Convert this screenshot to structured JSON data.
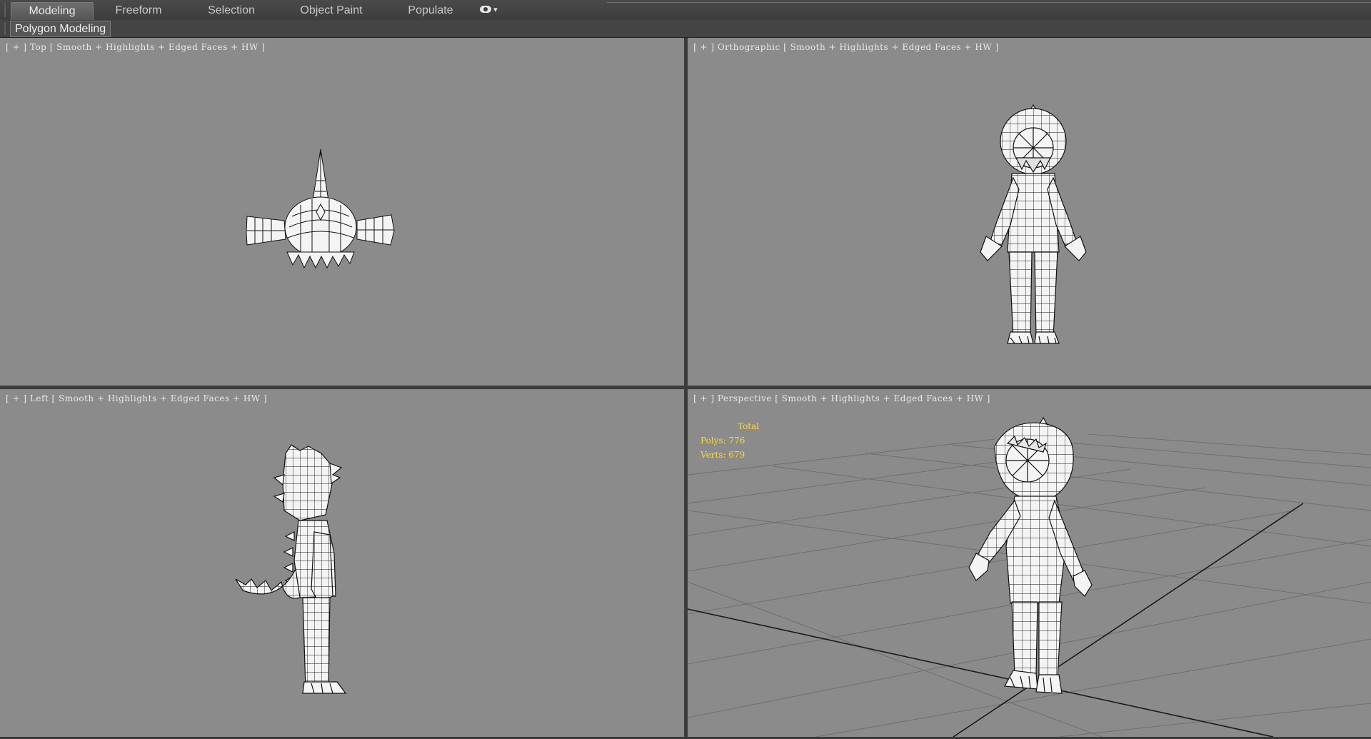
{
  "ribbon": {
    "tabs": [
      {
        "label": "Modeling",
        "active": true
      },
      {
        "label": "Freeform",
        "active": false
      },
      {
        "label": "Selection",
        "active": false
      },
      {
        "label": "Object Paint",
        "active": false
      },
      {
        "label": "Populate",
        "active": false
      }
    ],
    "extension_arrow": "▾"
  },
  "subribbon": {
    "label": "Polygon Modeling"
  },
  "viewports": {
    "top": {
      "plus": "[ + ]",
      "view": "Top",
      "shading": "[ Smooth + Highlights + Edged Faces + HW ]"
    },
    "orthographic": {
      "plus": "[ + ]",
      "view": "Orthographic",
      "shading": "[ Smooth + Highlights + Edged Faces + HW ]"
    },
    "left": {
      "plus": "[ + ]",
      "view": "Left",
      "shading": "[ Smooth + Highlights + Edged Faces + HW ]"
    },
    "perspective": {
      "plus": "[ + ]",
      "view": "Perspective",
      "shading": "[ Smooth + Highlights + Edged Faces + HW ]",
      "stats": {
        "title": "Total",
        "polys": "Polys: 776",
        "verts": "Verts: 679"
      }
    }
  },
  "colors": {
    "viewport_bg": "#8b8b8b",
    "ui_bg": "#3c3c3c",
    "stats_text": "#ffd83a",
    "mesh_fill": "#f4f4f4",
    "mesh_wire": "#111111"
  }
}
